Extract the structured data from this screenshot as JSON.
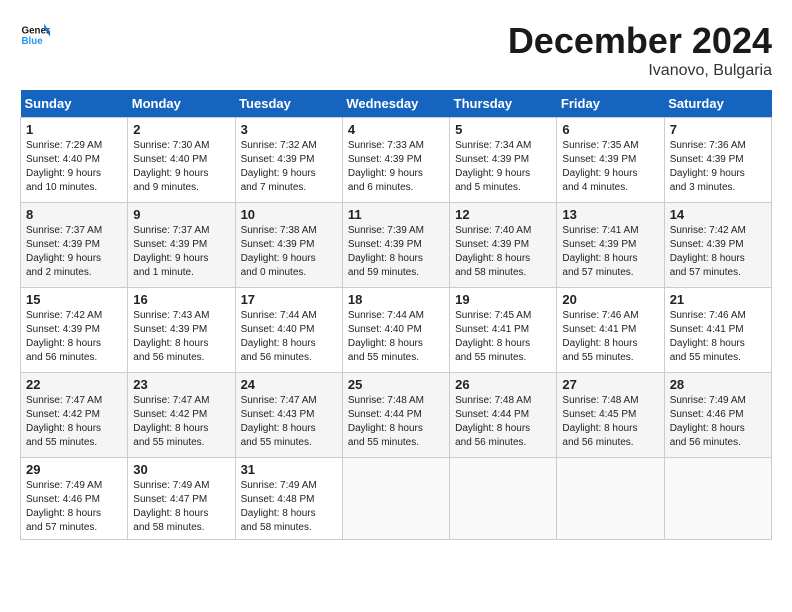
{
  "header": {
    "logo_line1": "General",
    "logo_line2": "Blue",
    "month": "December 2024",
    "location": "Ivanovo, Bulgaria"
  },
  "columns": [
    "Sunday",
    "Monday",
    "Tuesday",
    "Wednesday",
    "Thursday",
    "Friday",
    "Saturday"
  ],
  "weeks": [
    [
      {
        "day": "1",
        "text": "Sunrise: 7:29 AM\nSunset: 4:40 PM\nDaylight: 9 hours\nand 10 minutes."
      },
      {
        "day": "2",
        "text": "Sunrise: 7:30 AM\nSunset: 4:40 PM\nDaylight: 9 hours\nand 9 minutes."
      },
      {
        "day": "3",
        "text": "Sunrise: 7:32 AM\nSunset: 4:39 PM\nDaylight: 9 hours\nand 7 minutes."
      },
      {
        "day": "4",
        "text": "Sunrise: 7:33 AM\nSunset: 4:39 PM\nDaylight: 9 hours\nand 6 minutes."
      },
      {
        "day": "5",
        "text": "Sunrise: 7:34 AM\nSunset: 4:39 PM\nDaylight: 9 hours\nand 5 minutes."
      },
      {
        "day": "6",
        "text": "Sunrise: 7:35 AM\nSunset: 4:39 PM\nDaylight: 9 hours\nand 4 minutes."
      },
      {
        "day": "7",
        "text": "Sunrise: 7:36 AM\nSunset: 4:39 PM\nDaylight: 9 hours\nand 3 minutes."
      }
    ],
    [
      {
        "day": "8",
        "text": "Sunrise: 7:37 AM\nSunset: 4:39 PM\nDaylight: 9 hours\nand 2 minutes."
      },
      {
        "day": "9",
        "text": "Sunrise: 7:37 AM\nSunset: 4:39 PM\nDaylight: 9 hours\nand 1 minute."
      },
      {
        "day": "10",
        "text": "Sunrise: 7:38 AM\nSunset: 4:39 PM\nDaylight: 9 hours\nand 0 minutes."
      },
      {
        "day": "11",
        "text": "Sunrise: 7:39 AM\nSunset: 4:39 PM\nDaylight: 8 hours\nand 59 minutes."
      },
      {
        "day": "12",
        "text": "Sunrise: 7:40 AM\nSunset: 4:39 PM\nDaylight: 8 hours\nand 58 minutes."
      },
      {
        "day": "13",
        "text": "Sunrise: 7:41 AM\nSunset: 4:39 PM\nDaylight: 8 hours\nand 57 minutes."
      },
      {
        "day": "14",
        "text": "Sunrise: 7:42 AM\nSunset: 4:39 PM\nDaylight: 8 hours\nand 57 minutes."
      }
    ],
    [
      {
        "day": "15",
        "text": "Sunrise: 7:42 AM\nSunset: 4:39 PM\nDaylight: 8 hours\nand 56 minutes."
      },
      {
        "day": "16",
        "text": "Sunrise: 7:43 AM\nSunset: 4:39 PM\nDaylight: 8 hours\nand 56 minutes."
      },
      {
        "day": "17",
        "text": "Sunrise: 7:44 AM\nSunset: 4:40 PM\nDaylight: 8 hours\nand 56 minutes."
      },
      {
        "day": "18",
        "text": "Sunrise: 7:44 AM\nSunset: 4:40 PM\nDaylight: 8 hours\nand 55 minutes."
      },
      {
        "day": "19",
        "text": "Sunrise: 7:45 AM\nSunset: 4:41 PM\nDaylight: 8 hours\nand 55 minutes."
      },
      {
        "day": "20",
        "text": "Sunrise: 7:46 AM\nSunset: 4:41 PM\nDaylight: 8 hours\nand 55 minutes."
      },
      {
        "day": "21",
        "text": "Sunrise: 7:46 AM\nSunset: 4:41 PM\nDaylight: 8 hours\nand 55 minutes."
      }
    ],
    [
      {
        "day": "22",
        "text": "Sunrise: 7:47 AM\nSunset: 4:42 PM\nDaylight: 8 hours\nand 55 minutes."
      },
      {
        "day": "23",
        "text": "Sunrise: 7:47 AM\nSunset: 4:42 PM\nDaylight: 8 hours\nand 55 minutes."
      },
      {
        "day": "24",
        "text": "Sunrise: 7:47 AM\nSunset: 4:43 PM\nDaylight: 8 hours\nand 55 minutes."
      },
      {
        "day": "25",
        "text": "Sunrise: 7:48 AM\nSunset: 4:44 PM\nDaylight: 8 hours\nand 55 minutes."
      },
      {
        "day": "26",
        "text": "Sunrise: 7:48 AM\nSunset: 4:44 PM\nDaylight: 8 hours\nand 56 minutes."
      },
      {
        "day": "27",
        "text": "Sunrise: 7:48 AM\nSunset: 4:45 PM\nDaylight: 8 hours\nand 56 minutes."
      },
      {
        "day": "28",
        "text": "Sunrise: 7:49 AM\nSunset: 4:46 PM\nDaylight: 8 hours\nand 56 minutes."
      }
    ],
    [
      {
        "day": "29",
        "text": "Sunrise: 7:49 AM\nSunset: 4:46 PM\nDaylight: 8 hours\nand 57 minutes."
      },
      {
        "day": "30",
        "text": "Sunrise: 7:49 AM\nSunset: 4:47 PM\nDaylight: 8 hours\nand 58 minutes."
      },
      {
        "day": "31",
        "text": "Sunrise: 7:49 AM\nSunset: 4:48 PM\nDaylight: 8 hours\nand 58 minutes."
      },
      {
        "day": "",
        "text": ""
      },
      {
        "day": "",
        "text": ""
      },
      {
        "day": "",
        "text": ""
      },
      {
        "day": "",
        "text": ""
      }
    ]
  ]
}
